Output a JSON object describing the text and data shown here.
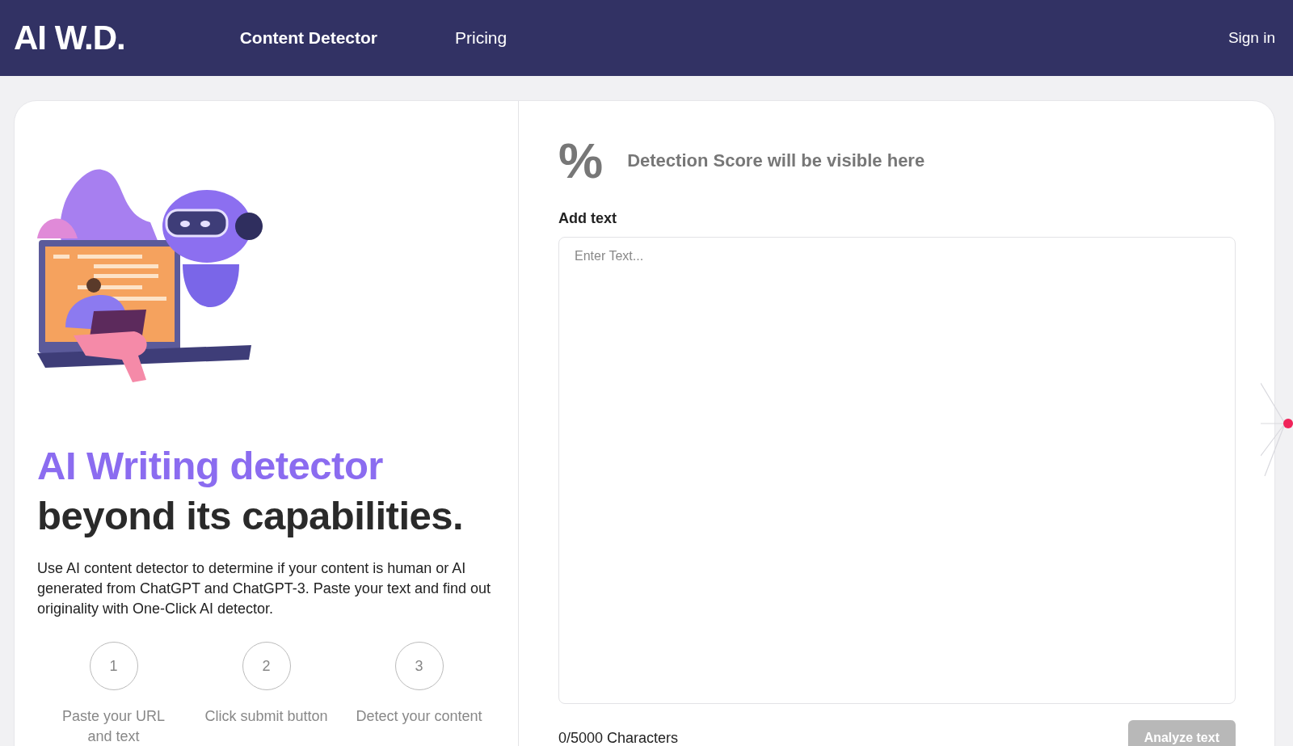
{
  "header": {
    "logo": "AI W.D.",
    "nav": [
      {
        "label": "Content Detector",
        "selected": true
      },
      {
        "label": "Pricing",
        "selected": false
      }
    ],
    "sign_in": "Sign in"
  },
  "hero": {
    "title_highlight": "AI Writing detector",
    "title_rest": "beyond its capabilities.",
    "description": "Use AI content detector to determine if your content is human or AI generated from ChatGPT and ChatGPT-3. Paste your text and find out originality with One-Click AI detector.",
    "steps": [
      {
        "number": "1",
        "label": "Paste your URL and text"
      },
      {
        "number": "2",
        "label": "Click submit button"
      },
      {
        "number": "3",
        "label": "Detect your content"
      }
    ]
  },
  "detector": {
    "score_symbol": "%",
    "score_text": "Detection Score will be visible here",
    "field_label": "Add text",
    "placeholder": "Enter Text...",
    "char_count": "0/5000 Characters",
    "button": {
      "label": "Analyze text",
      "disabled": true
    }
  }
}
